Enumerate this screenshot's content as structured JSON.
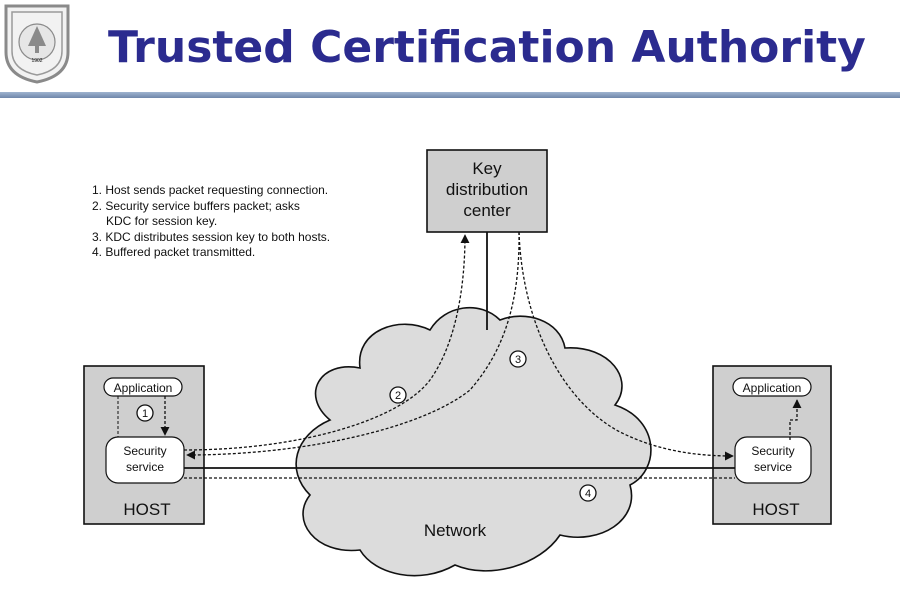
{
  "slide": {
    "title": "Trusted Certification Authority"
  },
  "logo": {
    "year": "1902",
    "arc_text": "NANJING UNIVERSITY"
  },
  "steps": [
    "1. Host sends packet requesting connection.",
    "2. Security service buffers packet; asks",
    "KDC for session key.",
    "3. KDC distributes session key to both hosts.",
    "4. Buffered packet transmitted."
  ],
  "diagram": {
    "kdc": {
      "line1": "Key",
      "line2": "distribution",
      "line3": "center"
    },
    "left_host": {
      "label": "HOST",
      "application": "Application",
      "security_line1": "Security",
      "security_line2": "service"
    },
    "right_host": {
      "label": "HOST",
      "application": "Application",
      "security_line1": "Security",
      "security_line2": "service"
    },
    "network_label": "Network",
    "step_markers": [
      "1",
      "2",
      "3",
      "4"
    ]
  },
  "colors": {
    "title": "#2b2b8f",
    "box_fill": "#cfcfcf",
    "cloud_fill": "#dcdcdc",
    "rule": "#7f95b8"
  }
}
